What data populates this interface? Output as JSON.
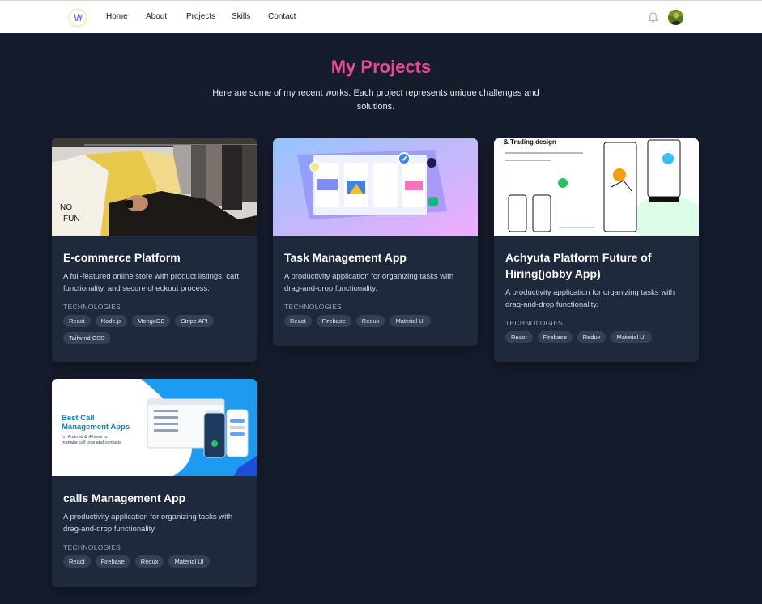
{
  "nav": {
    "links": [
      "Home",
      "About",
      "Projects",
      "Skills",
      "Contact"
    ]
  },
  "header": {
    "title": "My Projects",
    "subtitle": "Here are some of my recent works. Each project represents unique challenges and solutions."
  },
  "colors": {
    "accent": "#ec4899",
    "page_bg": "#151c2c",
    "card_bg": "#1e293b",
    "tag_bg": "#334155"
  },
  "projects": [
    {
      "title": "E-commerce Platform",
      "description": "A full-featured online store with product listings, cart functionality, and secure checkout process.",
      "tech_label": "TECHNOLOGIES",
      "tags": [
        "React",
        "Node.js",
        "MongoDB",
        "Stripe API",
        "Tailwind CSS"
      ]
    },
    {
      "title": "Task Management App",
      "description": "A productivity application for organizing tasks with drag-and-drop functionality.",
      "tech_label": "TECHNOLOGIES",
      "tags": [
        "React",
        "Firebase",
        "Redux",
        "Material UI"
      ]
    },
    {
      "title": "Achyuta Platform Future of Hiring(jobby App)",
      "description": "A productivity application for organizing tasks with drag-and-drop functionality.",
      "tech_label": "TECHNOLOGIES",
      "tags": [
        "React",
        "Firebase",
        "Redux",
        "Material UI"
      ],
      "image_text": "& Trading design"
    },
    {
      "title": "calls Management App",
      "description": "A productivity application for organizing tasks with drag-and-drop functionality.",
      "tech_label": "TECHNOLOGIES",
      "tags": [
        "React",
        "Firebase",
        "Redux",
        "Material UI"
      ],
      "image_text": {
        "headline_1": "Best Call",
        "headline_2": "Management Apps",
        "sub_1": "for Android & iPhone to",
        "sub_2": "manage call logs and contacts"
      }
    }
  ]
}
